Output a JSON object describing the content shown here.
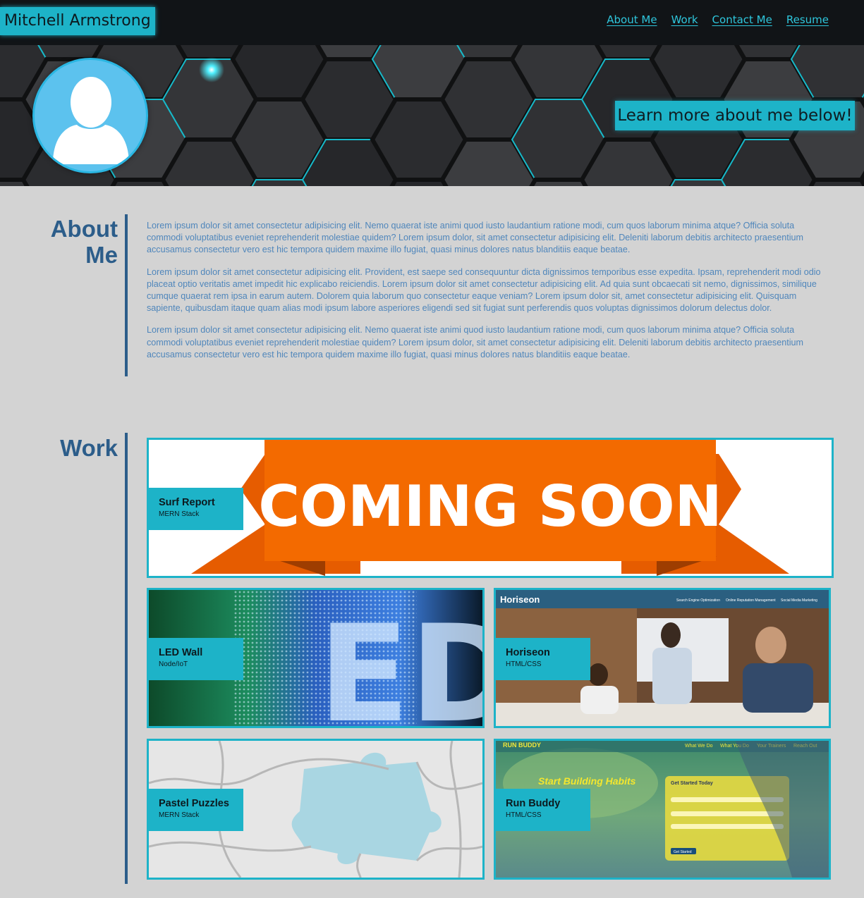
{
  "header": {
    "brand": "Mitchell Armstrong",
    "nav": [
      "About Me",
      "Work",
      "Contact Me",
      "Resume"
    ]
  },
  "hero": {
    "tagline": "Learn more about me below!"
  },
  "about": {
    "title_line1": "About",
    "title_line2": "Me",
    "paragraphs": [
      "Lorem ipsum dolor sit amet consectetur adipisicing elit. Nemo quaerat iste animi quod iusto laudantium ratione modi, cum quos laborum minima atque? Officia soluta commodi voluptatibus eveniet reprehenderit molestiae quidem? Lorem ipsum dolor, sit amet consectetur adipisicing elit. Deleniti laborum debitis architecto praesentium accusamus consectetur vero est hic tempora quidem maxime illo fugiat, quasi minus dolores natus blanditiis eaque beatae.",
      "Lorem ipsum dolor sit amet consectetur adipisicing elit. Provident, est saepe sed consequuntur dicta dignissimos temporibus esse expedita. Ipsam, reprehenderit modi odio placeat optio veritatis amet impedit hic explicabo reiciendis. Lorem ipsum dolor sit amet consectetur adipisicing elit. Ad quia sunt obcaecati sit nemo, dignissimos, similique cumque quaerat rem ipsa in earum autem. Dolorem quia laborum quo consectetur eaque veniam? Lorem ipsum dolor sit, amet consectetur adipisicing elit. Quisquam sapiente, quibusdam itaque quam alias modi ipsum labore asperiores eligendi sed sit fugiat sunt perferendis quos voluptas dignissimos dolorum delectus dolor.",
      "Lorem ipsum dolor sit amet consectetur adipisicing elit. Nemo quaerat iste animi quod iusto laudantium ratione modi, cum quos laborum minima atque? Officia soluta commodi voluptatibus eveniet reprehenderit molestiae quidem? Lorem ipsum dolor, sit amet consectetur adipisicing elit. Deleniti laborum debitis architecto praesentium accusamus consectetur vero est hic tempora quidem maxime illo fugiat, quasi minus dolores natus blanditiis eaque beatae."
    ]
  },
  "work": {
    "title": "Work",
    "projects": [
      {
        "title": "Surf Report",
        "stack": "MERN Stack",
        "image_text": "COMING SOON"
      },
      {
        "title": "LED Wall",
        "stack": "Node/IoT",
        "image_text": "ED"
      },
      {
        "title": "Horiseon",
        "stack": "HTML/CSS",
        "image_text": "Horiseon",
        "image_nav": [
          "Search Engine Optimization",
          "Online Reputation Management",
          "Social Media Marketing"
        ]
      },
      {
        "title": "Pastel Puzzles",
        "stack": "MERN Stack"
      },
      {
        "title": "Run Buddy",
        "stack": "HTML/CSS",
        "image_text": "RUN BUDDY",
        "image_nav": [
          "What We Do",
          "What You Do",
          "Your Trainers",
          "Reach Out"
        ],
        "image_headline": "Start Building Habits",
        "image_form_title": "Get Started Today",
        "image_form_button": "Get Started"
      }
    ]
  },
  "colors": {
    "accent": "#1db3c8",
    "heading": "#2c5d8a",
    "body_text": "#4f86bb",
    "bg": "#d3d3d3",
    "topbar": "#111417"
  }
}
